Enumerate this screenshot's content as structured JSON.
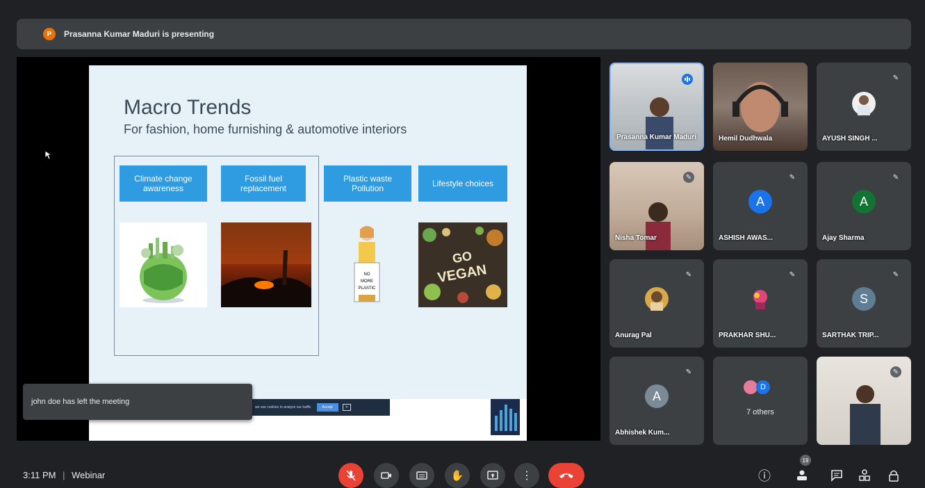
{
  "banner": {
    "avatar_letter": "P",
    "text": "Prasanna Kumar Maduri is presenting"
  },
  "slide": {
    "title": "Macro Trends",
    "subtitle": "For fashion, home furnishing & automotive interiors",
    "cards": [
      {
        "label": "Climate change awareness"
      },
      {
        "label": "Fossil fuel replacement"
      },
      {
        "label": "Plastic waste Pollution"
      },
      {
        "label": "Lifestyle choices"
      }
    ],
    "vegan_text": "GO VEGAN",
    "plastic_sign": "NO MORE PLASTIC",
    "cookie_button": "Accept"
  },
  "toast": {
    "text": "john doe has left the meeting"
  },
  "participants": [
    {
      "name": "Prasanna Kumar Maduri",
      "type": "video",
      "speaking": true
    },
    {
      "name": "Hemil Dudhwala",
      "type": "video"
    },
    {
      "name": "AYUSH SINGH ...",
      "type": "video"
    },
    {
      "name": "Nisha Tomar",
      "type": "video"
    },
    {
      "name": "ASHISH AWAS...",
      "type": "avatar",
      "letter": "A",
      "color": "#1a73e8"
    },
    {
      "name": "Ajay Sharma",
      "type": "avatar",
      "letter": "A",
      "color": "#137333"
    },
    {
      "name": "Anurag Pal",
      "type": "photo"
    },
    {
      "name": "PRAKHAR SHU...",
      "type": "photo"
    },
    {
      "name": "SARTHAK TRIP...",
      "type": "avatar",
      "letter": "S",
      "color": "#5f7d95"
    },
    {
      "name": "Abhishek Kum...",
      "type": "avatar",
      "letter": "A",
      "color": "#7b8a97"
    },
    {
      "name": "7 others",
      "type": "others",
      "letter": "D"
    },
    {
      "name": "",
      "type": "video"
    }
  ],
  "bottom": {
    "time": "3:11 PM",
    "separator": "|",
    "meeting_name": "Webinar",
    "participant_count": "19"
  },
  "colors": {
    "accent_red": "#ea4335",
    "card_blue": "#2f9be0",
    "tile_bg": "#3c4043"
  }
}
